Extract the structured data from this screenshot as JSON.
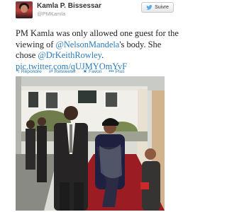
{
  "header": {
    "name": "Kamla P. Bissessar",
    "handle": "@PMKamla",
    "follow_label": "Suivre"
  },
  "tweet": {
    "part1": "PM Kamla was only allowed one guest for the viewing of ",
    "mention1": "@NelsonMandela",
    "part2": "'s body. She chose ",
    "mention2": "@DrKeithRowley",
    "part3": ".",
    "link": "pic.twitter.com/qUJMYOmYvF"
  },
  "actions": {
    "reply_label": "Répondre",
    "retweet_label": "Retweeter",
    "favorite_label": "Favori",
    "more_label": "Plus"
  },
  "colors": {
    "link": "#2b7bb9",
    "follow_bird": "#55acee"
  }
}
